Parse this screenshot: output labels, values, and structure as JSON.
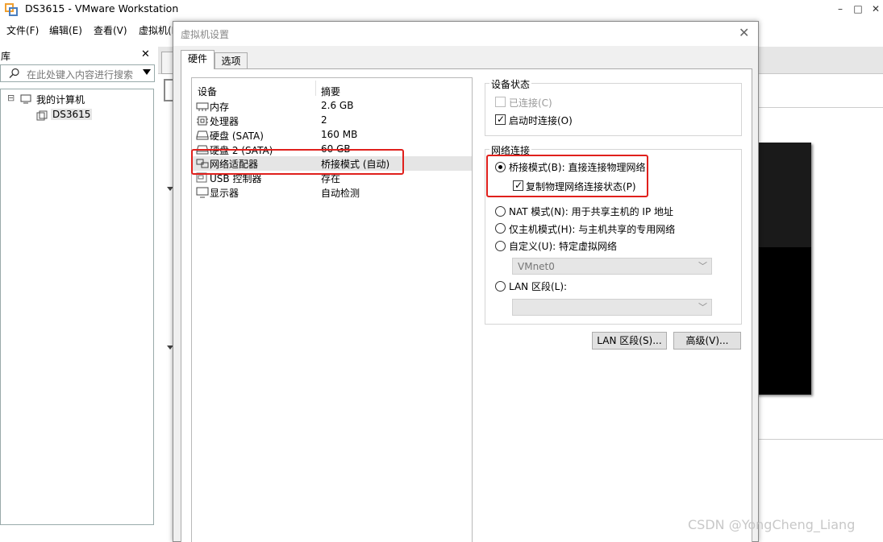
{
  "app": {
    "title": "DS3615 - VMware Workstation",
    "menu": [
      "文件(F)",
      "编辑(E)",
      "查看(V)",
      "虚拟机(M"
    ],
    "window_controls": [
      "–",
      "□",
      "✕"
    ]
  },
  "library": {
    "title": "库",
    "close": "✕",
    "search_placeholder": "在此处键入内容进行搜索",
    "tree": {
      "root": "我的计算机",
      "child": "DS3615"
    }
  },
  "dialog": {
    "title": "虚拟机设置",
    "close": "✕",
    "tabs": [
      "硬件",
      "选项"
    ],
    "device_table": {
      "headers": [
        "设备",
        "摘要"
      ],
      "rows": [
        {
          "icon": "memory-icon",
          "name": "内存",
          "summary": "2.6 GB"
        },
        {
          "icon": "processor-icon",
          "name": "处理器",
          "summary": "2"
        },
        {
          "icon": "hard-disk-icon",
          "name": "硬盘 (SATA)",
          "summary": "160 MB"
        },
        {
          "icon": "hard-disk-icon",
          "name": "硬盘 2 (SATA)",
          "summary": "60 GB"
        },
        {
          "icon": "network-adapter-icon",
          "name": "网络适配器",
          "summary": "桥接模式 (自动)"
        },
        {
          "icon": "usb-icon",
          "name": "USB 控制器",
          "summary": "存在"
        },
        {
          "icon": "display-icon",
          "name": "显示器",
          "summary": "自动检测"
        }
      ],
      "selected_index": 4
    },
    "device_status": {
      "label": "设备状态",
      "connected": {
        "label": "已连接(C)",
        "checked": false,
        "enabled": false
      },
      "connect_at_power_on": {
        "label": "启动时连接(O)",
        "checked": true,
        "enabled": true
      }
    },
    "network_connection": {
      "label": "网络连接",
      "bridged": {
        "label": "桥接模式(B): 直接连接物理网络",
        "selected": true
      },
      "replicate_state": {
        "label": "复制物理网络连接状态(P)",
        "checked": true
      },
      "nat": {
        "label": "NAT 模式(N): 用于共享主机的 IP 地址",
        "selected": false
      },
      "host_only": {
        "label": "仅主机模式(H): 与主机共享的专用网络",
        "selected": false
      },
      "custom": {
        "label": "自定义(U): 特定虚拟网络",
        "selected": false
      },
      "custom_select_value": "VMnet0",
      "lan_segment": {
        "label": "LAN 区段(L):",
        "selected": false
      },
      "lan_select_value": ""
    },
    "buttons": {
      "lan_segments": "LAN 区段(S)...",
      "advanced": "高级(V)..."
    }
  },
  "watermark": "CSDN @YongCheng_Liang",
  "colors": {
    "highlight_box": "#e0201c",
    "selected_row": "#e5e5e5"
  }
}
